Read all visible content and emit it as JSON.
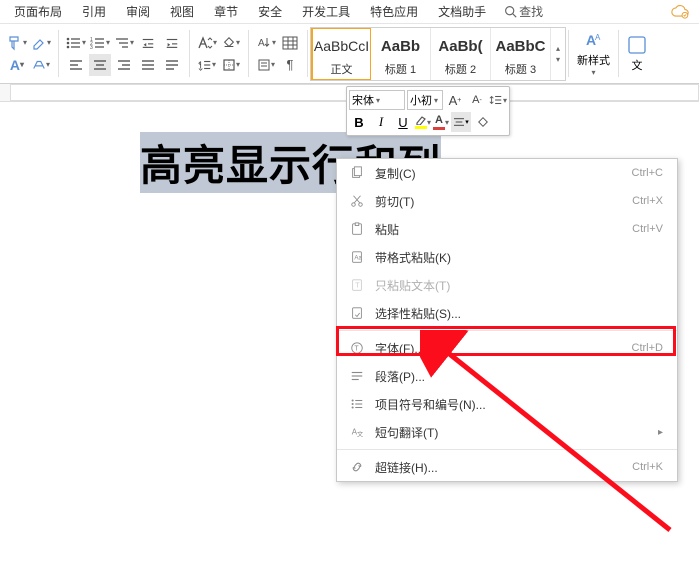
{
  "menu": {
    "items": [
      "页面布局",
      "引用",
      "审阅",
      "视图",
      "章节",
      "安全",
      "开发工具",
      "特色应用",
      "文档助手"
    ],
    "search": "查找"
  },
  "toolbar": {
    "styles": [
      {
        "preview": "AaBbCcI",
        "name": "正文",
        "bold": false,
        "selected": true
      },
      {
        "preview": "AaBb",
        "name": "标题 1",
        "bold": true,
        "selected": false
      },
      {
        "preview": "AaBb(",
        "name": "标题 2",
        "bold": true,
        "selected": false
      },
      {
        "preview": "AaBbC",
        "name": "标题 3",
        "bold": true,
        "selected": false
      }
    ],
    "newstyle": "新样式",
    "wen": "文"
  },
  "float_toolbar": {
    "font": "宋体",
    "size": "小初"
  },
  "document": {
    "selected_text": "高亮显示行和列"
  },
  "context_menu": {
    "items": [
      {
        "icon": "copy",
        "label": "复制(C)",
        "shortcut": "Ctrl+C"
      },
      {
        "icon": "cut",
        "label": "剪切(T)",
        "shortcut": "Ctrl+X"
      },
      {
        "icon": "paste",
        "label": "粘贴",
        "shortcut": "Ctrl+V"
      },
      {
        "icon": "paste-format",
        "label": "带格式粘贴(K)",
        "shortcut": ""
      },
      {
        "icon": "paste-text",
        "label": "只粘贴文本(T)",
        "shortcut": "",
        "disabled": true
      },
      {
        "icon": "paste-special",
        "label": "选择性粘贴(S)...",
        "shortcut": ""
      },
      {
        "sep": true
      },
      {
        "icon": "font",
        "label": "字体(F)...",
        "shortcut": "Ctrl+D",
        "target": true
      },
      {
        "icon": "paragraph",
        "label": "段落(P)...",
        "shortcut": ""
      },
      {
        "icon": "bullets",
        "label": "项目符号和编号(N)...",
        "shortcut": ""
      },
      {
        "icon": "translate",
        "label": "短句翻译(T)",
        "shortcut": "",
        "arrow": true
      },
      {
        "sep": true
      },
      {
        "icon": "link",
        "label": "超链接(H)...",
        "shortcut": "Ctrl+K"
      }
    ]
  }
}
